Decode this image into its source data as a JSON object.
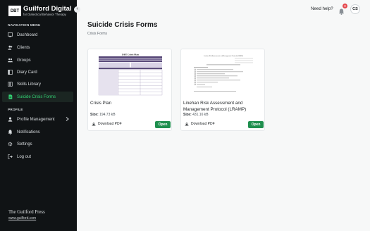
{
  "brand": {
    "logo_text": "DBT",
    "title": "Guilford Digital",
    "subtitle": "for Dialectical Behavior Therapy"
  },
  "sidebar": {
    "nav_header": "NAVIGATION MENU",
    "nav_items": [
      {
        "label": "Dashboard",
        "icon": "dashboard-icon"
      },
      {
        "label": "Clients",
        "icon": "users-icon"
      },
      {
        "label": "Groups",
        "icon": "group-icon"
      },
      {
        "label": "Diary Card",
        "icon": "diary-card-icon"
      },
      {
        "label": "Skills Library",
        "icon": "book-icon"
      },
      {
        "label": "Suicide Crisis Forms",
        "icon": "crisis-form-icon",
        "active": true
      }
    ],
    "profile_header": "PROFILE",
    "profile_items": [
      {
        "label": "Profile Management",
        "icon": "user-icon",
        "has_submenu": true
      },
      {
        "label": "Notifications",
        "icon": "bell-icon"
      },
      {
        "label": "Settings",
        "icon": "gear-icon"
      },
      {
        "label": "Log out",
        "icon": "logout-icon"
      }
    ],
    "footer_publisher": "The Guilford Press",
    "footer_url": "www.guilford.com"
  },
  "header": {
    "help_label": "Need help?",
    "notification_count": "0",
    "avatar_initials": "CS"
  },
  "main": {
    "title": "Suicide Crisis Forms",
    "breadcrumb": "Crisis Forms",
    "cards": [
      {
        "thumb_heading": "DBT Crisis Plan",
        "title": "Crisis Plan",
        "size_label": "Size:",
        "size_value": "194.73 kB",
        "download_label": "Download PDF",
        "open_label": "Open"
      },
      {
        "thumb_heading": "Linehan Risk Assessment and Management Protocol (LRAMP)",
        "title": "Linehan Risk Assessment and Management Protocol (LRAMP)",
        "size_label": "Size:",
        "size_value": "431.16 kB",
        "download_label": "Download PDF",
        "open_label": "Open"
      }
    ]
  },
  "colors": {
    "sidebar_bg": "#101315",
    "active_accent": "#33d675",
    "open_button": "#1f8f4e",
    "badge": "#e5484d",
    "form_header": "#5a4b7a"
  }
}
